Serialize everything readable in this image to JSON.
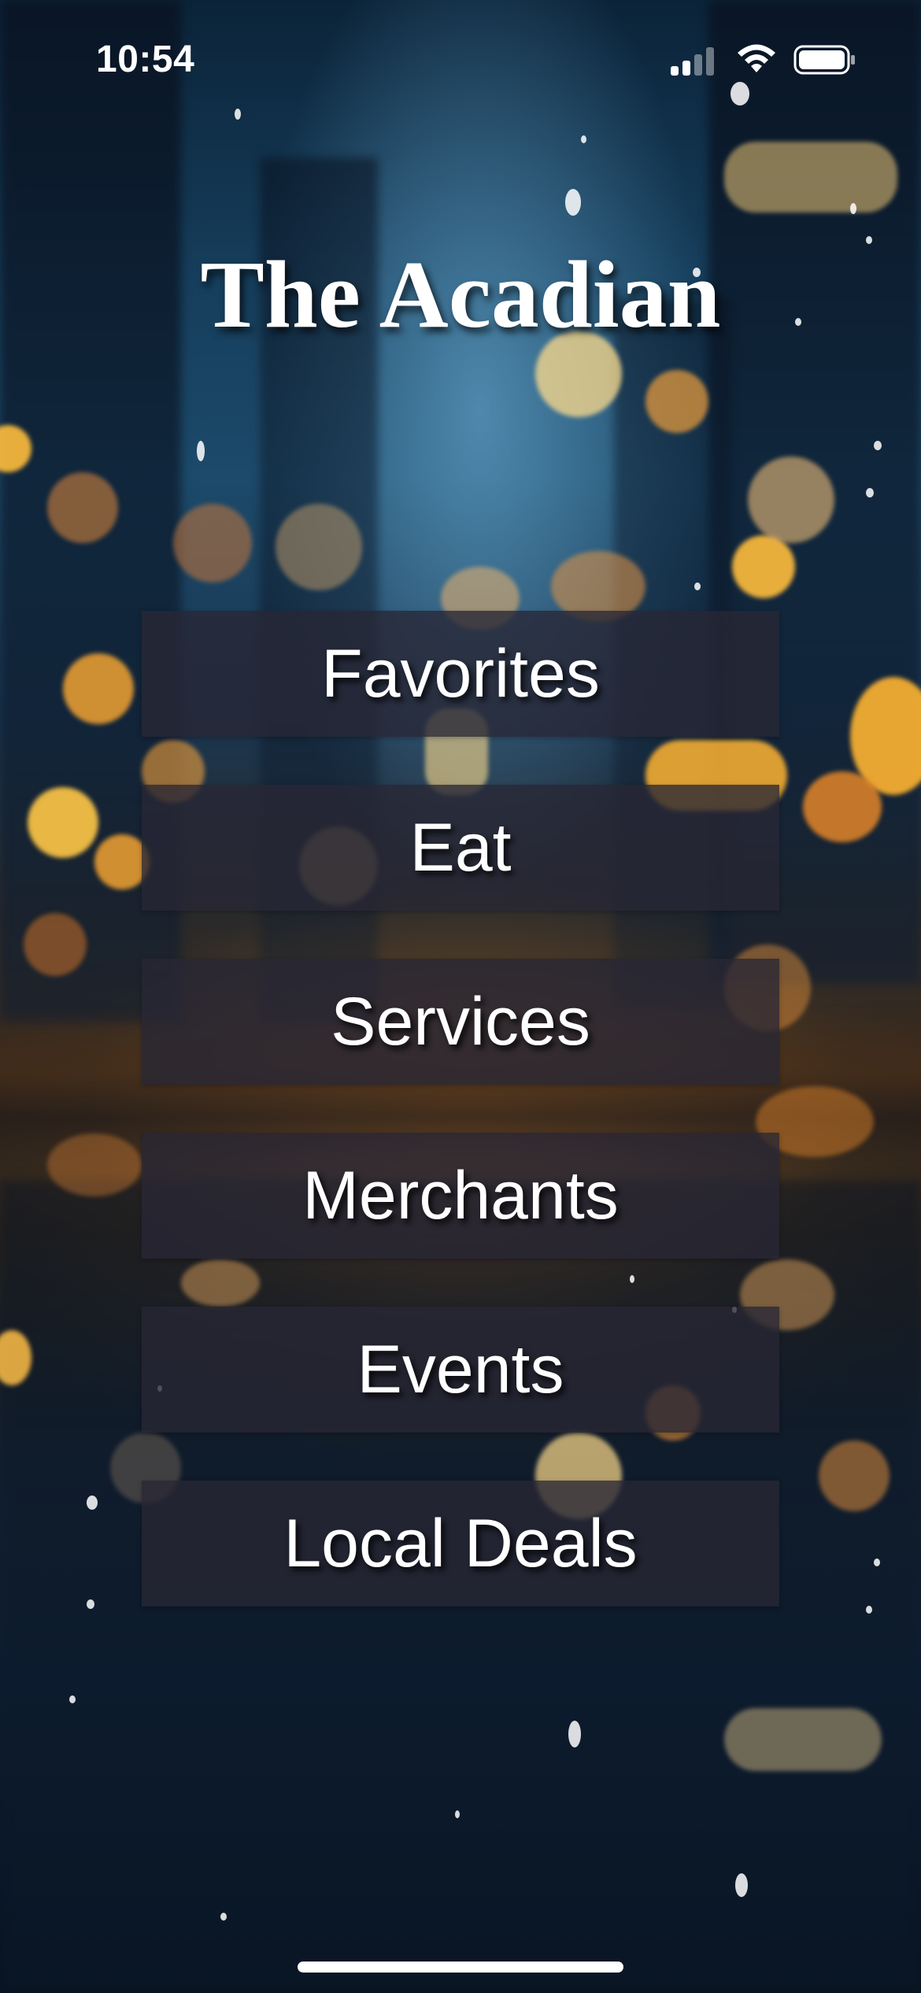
{
  "status_bar": {
    "time": "10:54",
    "signal_icon": "cellular-signal-icon",
    "wifi_icon": "wifi-icon",
    "battery_icon": "battery-icon"
  },
  "app": {
    "title": "The Acadian"
  },
  "menu": {
    "items": [
      {
        "label": "Favorites"
      },
      {
        "label": "Eat"
      },
      {
        "label": "Services"
      },
      {
        "label": "Merchants"
      },
      {
        "label": "Events"
      },
      {
        "label": "Local Deals"
      }
    ]
  },
  "colors": {
    "button_background": "#28263499",
    "text": "#ffffff",
    "bokeh_warm": "#f5b43c",
    "sky_blue": "#1c4a6a"
  }
}
